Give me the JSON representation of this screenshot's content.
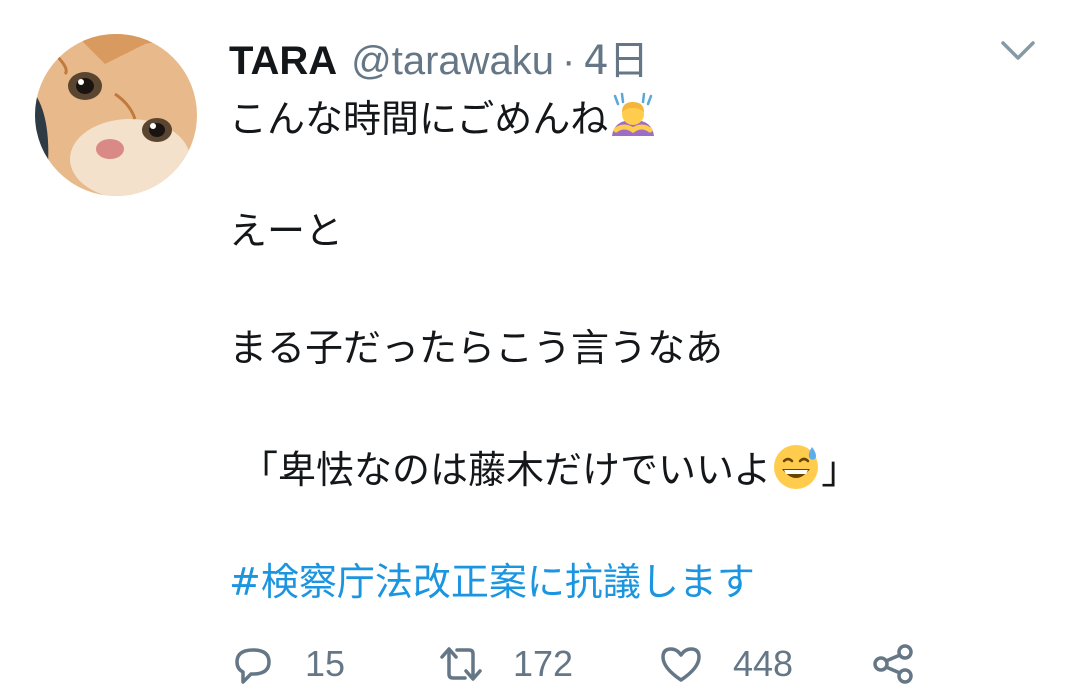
{
  "tweet": {
    "author_name": "TARA",
    "author_handle": "@tarawaku",
    "separator": "·",
    "time": "4日",
    "lines": {
      "line1": "こんな時間にごめんね",
      "line2": "えーと",
      "line3": "まる子だったらこう言うなあ",
      "line4_open": "「卑怯なのは藤木だけでいいよ",
      "line4_close": "」"
    },
    "hashtag": "#検察庁法改正案に抗議します",
    "emoji_names": [
      "person-bowing-emoji",
      "grinning-sweat-emoji"
    ]
  },
  "actions": {
    "reply_count": "15",
    "retweet_count": "172",
    "like_count": "448"
  },
  "icons": {
    "caret": "chevron-down-icon",
    "reply": "reply-icon",
    "retweet": "retweet-icon",
    "like": "heart-icon",
    "share": "share-icon"
  },
  "colors": {
    "text": "#14171a",
    "secondary": "#657786",
    "link": "#1b95e0"
  }
}
